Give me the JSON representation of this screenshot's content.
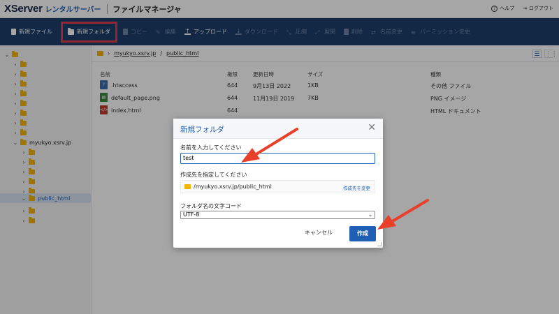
{
  "header": {
    "logo": "XServer",
    "logo_sub": "レンタルサーバー",
    "app_title": "ファイルマネージャ",
    "help_label": "ヘルプ",
    "logout_label": "ログアウト"
  },
  "toolbar": {
    "items": [
      {
        "label": "新規ファイル",
        "icon": "new-file-icon",
        "enabled": true
      },
      {
        "label": "新規フォルダ",
        "icon": "new-folder-icon",
        "enabled": true,
        "highlighted": true
      },
      {
        "label": "コピー",
        "icon": "copy-icon",
        "enabled": false
      },
      {
        "label": "編集",
        "icon": "edit-icon",
        "enabled": false
      },
      {
        "label": "アップロード",
        "icon": "upload-icon",
        "enabled": true
      },
      {
        "label": "ダウンロード",
        "icon": "download-icon",
        "enabled": false
      },
      {
        "label": "圧縮",
        "icon": "compress-icon",
        "enabled": false
      },
      {
        "label": "展開",
        "icon": "extract-icon",
        "enabled": false
      },
      {
        "label": "削除",
        "icon": "delete-icon",
        "enabled": false
      },
      {
        "label": "名前変更",
        "icon": "rename-icon",
        "enabled": false
      },
      {
        "label": "パーミッション変更",
        "icon": "permission-icon",
        "enabled": false
      }
    ]
  },
  "tree": {
    "domain_label": "myukyo.xsrv.jp",
    "selected_label": "public_html"
  },
  "breadcrumb": {
    "items": [
      "myukyo.xsrv.jp",
      "public_html"
    ]
  },
  "table": {
    "headers": {
      "name": "名前",
      "perm": "権限",
      "date": "更新日時",
      "size": "サイズ",
      "type": "種類"
    },
    "rows": [
      {
        "name": ".htaccess",
        "perm": "644",
        "date": "9月13日 2022",
        "size": "1KB",
        "type": "その他 ファイル",
        "icon": "unknown-file-icon"
      },
      {
        "name": "default_page.png",
        "perm": "644",
        "date": "11月19日 2019",
        "size": "7KB",
        "type": "PNG イメージ",
        "icon": "image-file-icon"
      },
      {
        "name": "index.html",
        "perm": "644",
        "date": "",
        "size": "",
        "type": "HTML ドキュメント",
        "icon": "html-file-icon"
      }
    ]
  },
  "dialog": {
    "title": "新規フォルダ",
    "name_label": "名前を入力してください",
    "name_value": "test",
    "dest_label": "作成先を指定してください",
    "dest_path": "/myukyo.xsrv.jp/public_html",
    "change_dest": "作成先を変更",
    "encoding_label": "フォルダ名の文字コード",
    "encoding_value": "UTF-8",
    "cancel_label": "キャンセル",
    "create_label": "作成"
  },
  "colors": {
    "toolbar_bg": "#1d3e6a",
    "accent": "#1f5fb5",
    "highlight": "#e23b4b",
    "annotation_arrow": "#e8402a"
  }
}
